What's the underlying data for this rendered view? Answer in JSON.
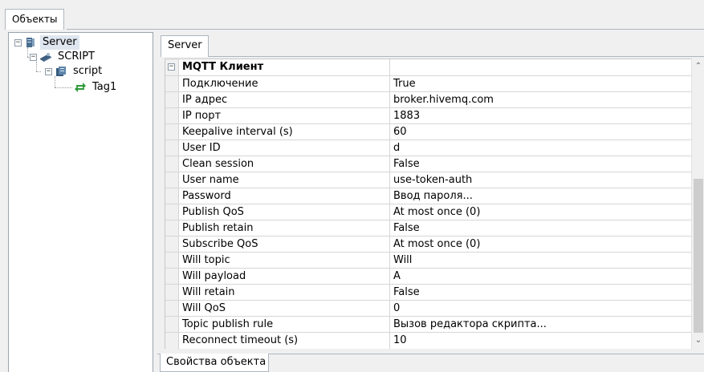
{
  "top_tab": {
    "label": "Объекты"
  },
  "tree": {
    "nodes": [
      {
        "label": "Server",
        "expander": "−",
        "icon": "server-icon"
      },
      {
        "label": "SCRIPT",
        "expander": "−",
        "icon": "script-module-icon"
      },
      {
        "label": "script",
        "expander": "−",
        "icon": "script-object-icon"
      },
      {
        "label": "Tag1",
        "icon": "tag-icon"
      }
    ]
  },
  "object_tab": {
    "label": "Server"
  },
  "properties": {
    "category": {
      "label": "MQTT Клиент",
      "toggle": "−"
    },
    "rows": [
      {
        "name": "Подключение",
        "value": "True"
      },
      {
        "name": "IP адрес",
        "value": "broker.hivemq.com"
      },
      {
        "name": "IP порт",
        "value": "1883"
      },
      {
        "name": "Keepalive interval (s)",
        "value": "60"
      },
      {
        "name": "User ID",
        "value": "d"
      },
      {
        "name": "Clean session",
        "value": "False"
      },
      {
        "name": "User name",
        "value": "use-token-auth"
      },
      {
        "name": "Password",
        "value": "Ввод пароля..."
      },
      {
        "name": "Publish QoS",
        "value": "At most once (0)"
      },
      {
        "name": "Publish retain",
        "value": "False"
      },
      {
        "name": "Subscribe QoS",
        "value": "At most once (0)"
      },
      {
        "name": "Will topic",
        "value": "Will"
      },
      {
        "name": "Will payload",
        "value": "A"
      },
      {
        "name": "Will retain",
        "value": "False"
      },
      {
        "name": "Will QoS",
        "value": "0"
      },
      {
        "name": "Topic publish rule",
        "value": "Вызов редактора скрипта..."
      },
      {
        "name": "Reconnect timeout (s)",
        "value": "10"
      }
    ]
  },
  "scrollbar": {
    "up": "⌃",
    "down": "⌄"
  },
  "bottom_tab": {
    "label": "Свойства объекта"
  },
  "colors": {
    "panel_bg": "#f0f0f0",
    "grid_line": "#d6d6d6",
    "selection": "#dfe6ef",
    "tag_icon": "#2e9b3a"
  }
}
